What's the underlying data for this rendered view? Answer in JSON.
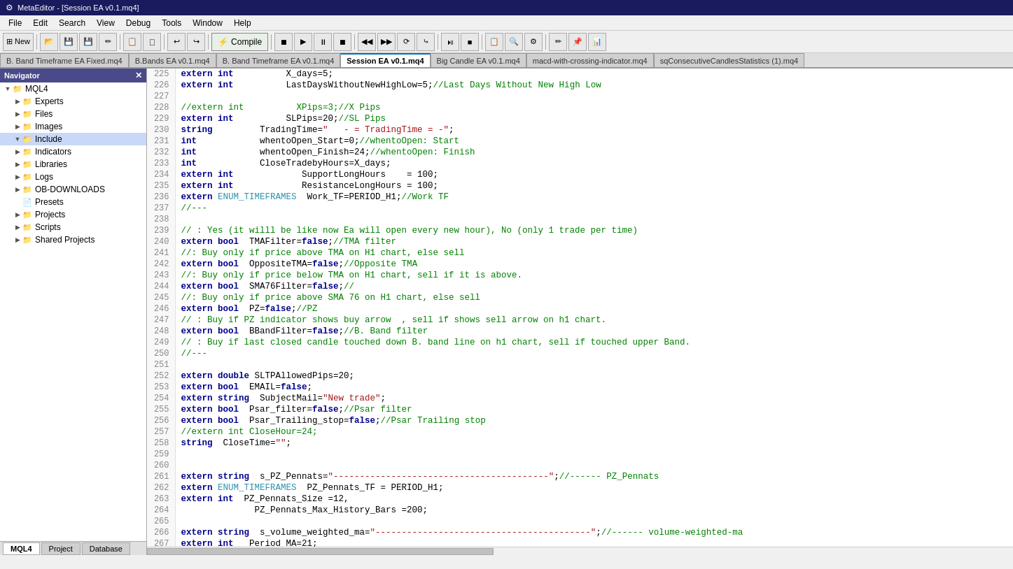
{
  "titleBar": {
    "label": "MetaEditor - [Session EA v0.1.mq4]",
    "icon": "M"
  },
  "menuBar": {
    "items": [
      "File",
      "Edit",
      "Search",
      "View",
      "Debug",
      "Tools",
      "Window",
      "Help"
    ]
  },
  "toolbar": {
    "new_label": "New",
    "compile_label": "Compile",
    "back_label": "◀",
    "forward_label": "▶"
  },
  "tabs": [
    {
      "label": "B. Band Timeframe EA Fixed.mq4",
      "active": false
    },
    {
      "label": "B.Bands EA v0.1.mq4",
      "active": false
    },
    {
      "label": "B. Band Timeframe EA v0.1.mq4",
      "active": false
    },
    {
      "label": "Session EA v0.1.mq4",
      "active": true
    },
    {
      "label": "Big Candle EA v0.1.mq4",
      "active": false
    },
    {
      "label": "macd-with-crossing-indicator.mq4",
      "active": false
    },
    {
      "label": "sqConsecutiveCandlesStatistics (1).mq4",
      "active": false
    }
  ],
  "navigator": {
    "title": "Navigator",
    "close_icon": "✕",
    "tree": [
      {
        "level": 0,
        "toggle": "▼",
        "icon": "📁",
        "label": "MQL4",
        "selected": false
      },
      {
        "level": 1,
        "toggle": "▶",
        "icon": "📁",
        "label": "Experts",
        "selected": false
      },
      {
        "level": 1,
        "toggle": "▶",
        "icon": "📁",
        "label": "Files",
        "selected": false
      },
      {
        "level": 1,
        "toggle": "▶",
        "icon": "📁",
        "label": "Images",
        "selected": false
      },
      {
        "level": 1,
        "toggle": "▼",
        "icon": "📁",
        "label": "Include",
        "selected": true
      },
      {
        "level": 1,
        "toggle": "▶",
        "icon": "📁",
        "label": "Indicators",
        "selected": false
      },
      {
        "level": 1,
        "toggle": "▶",
        "icon": "📁",
        "label": "Libraries",
        "selected": false
      },
      {
        "level": 1,
        "toggle": "▶",
        "icon": "📁",
        "label": "Logs",
        "selected": false
      },
      {
        "level": 1,
        "toggle": "▶",
        "icon": "📁",
        "label": "OB-DOWNLOADS",
        "selected": false
      },
      {
        "level": 1,
        "toggle": "",
        "icon": "📄",
        "label": "Presets",
        "selected": false
      },
      {
        "level": 1,
        "toggle": "▶",
        "icon": "📁",
        "label": "Projects",
        "selected": false
      },
      {
        "level": 1,
        "toggle": "▶",
        "icon": "📁",
        "label": "Scripts",
        "selected": false
      },
      {
        "level": 1,
        "toggle": "▶",
        "icon": "📁",
        "label": "Shared Projects",
        "selected": false
      }
    ]
  },
  "bottomTabs": [
    {
      "label": "MQL4",
      "active": true
    },
    {
      "label": "Project",
      "active": false
    },
    {
      "label": "Database",
      "active": false
    }
  ],
  "code": {
    "lines": [
      {
        "num": "225",
        "content": "<extern> <int>          X_days=5;"
      },
      {
        "num": "226",
        "content": "<extern> <int>          LastDaysWithoutNewHighLow=5;<comment>//Last Days Without New High Low</comment>"
      },
      {
        "num": "227",
        "content": ""
      },
      {
        "num": "228",
        "content": "<comment>//extern int          XPips=3;//X Pips</comment>"
      },
      {
        "num": "229",
        "content": "<extern> <int>          SLPips=20;<comment>//SL Pips</comment>"
      },
      {
        "num": "230",
        "content": "<string>         TradingTime=<str>\"   - = TradingTime = -\"</str>;"
      },
      {
        "num": "231",
        "content": "<int>            whentoOpen_Start=0;<comment>//whentoOpen: Start</comment>"
      },
      {
        "num": "232",
        "content": "<int>            whentoOpen_Finish=24;<comment>//whentoOpen: Finish</comment>"
      },
      {
        "num": "233",
        "content": "<int>            CloseTradebyHours=X_days;"
      },
      {
        "num": "234",
        "content": "<extern> <int>             SupportLongHours    = 100;"
      },
      {
        "num": "235",
        "content": "<extern> <int>             ResistanceLongHours = 100;"
      },
      {
        "num": "236",
        "content": "<extern> <type>ENUM_TIMEFRAMES</type>  Work_TF=PERIOD_H1;<comment>//Work TF</comment>"
      },
      {
        "num": "237",
        "content": "<comment>//---</comment>"
      },
      {
        "num": "238",
        "content": ""
      },
      {
        "num": "239",
        "content": "<comment>// : Yes (it willl be like now Ea will open every new hour), No (only 1 trade per time)</comment>"
      },
      {
        "num": "240",
        "content": "<extern> <bool>  TMAFilter=<false>false</false>;<comment>//TMA filter</comment>"
      },
      {
        "num": "241",
        "content": "<comment>//: Buy only if price above TMA on H1 chart, else sell</comment>"
      },
      {
        "num": "242",
        "content": "<extern> <bool>  OppositeTMA=<false>false</false>;<comment>//Opposite TMA</comment>"
      },
      {
        "num": "243",
        "content": "<comment>//: Buy only if price below TMA on H1 chart, sell if it is above.</comment>"
      },
      {
        "num": "244",
        "content": "<extern> <bool>  SMA76Filter=<false>false</false>;<comment>//</comment>"
      },
      {
        "num": "245",
        "content": "<comment>//: Buy only if price above SMA 76 on H1 chart, else sell</comment>"
      },
      {
        "num": "246",
        "content": "<extern> <bool>  PZ=<false>false</false>;<comment>//PZ</comment>"
      },
      {
        "num": "247",
        "content": "<comment>// : Buy if PZ indicator shows buy arrow  , sell if shows sell arrow on h1 chart.</comment>"
      },
      {
        "num": "248",
        "content": "<extern> <bool>  BBandFilter=<false>false</false>;<comment>//B. Band filter</comment>"
      },
      {
        "num": "249",
        "content": "<comment>// : Buy if last closed candle touched down B. band line on h1 chart, sell if touched upper Band.</comment>"
      },
      {
        "num": "250",
        "content": "<comment>//---</comment>"
      },
      {
        "num": "251",
        "content": ""
      },
      {
        "num": "252",
        "content": "<extern> <double> SLTPAllowedPips=20;"
      },
      {
        "num": "253",
        "content": "<extern> <bool>  EMAIL=<false>false</false>;"
      },
      {
        "num": "254",
        "content": "<extern> <string>  SubjectMail=<str>\"New trade\"</str>;"
      },
      {
        "num": "255",
        "content": "<extern> <bool>  Psar_filter=<false>false</false>;<comment>//Psar filter</comment>"
      },
      {
        "num": "256",
        "content": "<extern> <bool>  Psar_Trailing_stop=<false>false</false>;<comment>//Psar Trailing stop</comment>"
      },
      {
        "num": "257",
        "content": "<comment>//extern int CloseHour=24;</comment>"
      },
      {
        "num": "258",
        "content": "<string>  CloseTime=<str>\"\"</str>;"
      },
      {
        "num": "259",
        "content": ""
      },
      {
        "num": "260",
        "content": ""
      },
      {
        "num": "261",
        "content": "<extern> <string>  s_PZ_Pennats=<str>\"-----------------------------------------\"</str>;<comment>//------ PZ_Pennats</comment>"
      },
      {
        "num": "262",
        "content": "<extern> <type>ENUM_TIMEFRAMES</type>  PZ_Pennats_TF = PERIOD_H1;"
      },
      {
        "num": "263",
        "content": "<extern> <int>  PZ_Pennats_Size =12,"
      },
      {
        "num": "264",
        "content": "              PZ_Pennats_Max_History_Bars =200;"
      },
      {
        "num": "265",
        "content": ""
      },
      {
        "num": "266",
        "content": "<extern> <string>  s_volume_weighted_ma=<str>\"-----------------------------------------\"</str>;<comment>//------ volume-weighted-ma</comment>"
      },
      {
        "num": "267",
        "content": "<extern> <int>   Period_MA=21;"
      }
    ]
  }
}
